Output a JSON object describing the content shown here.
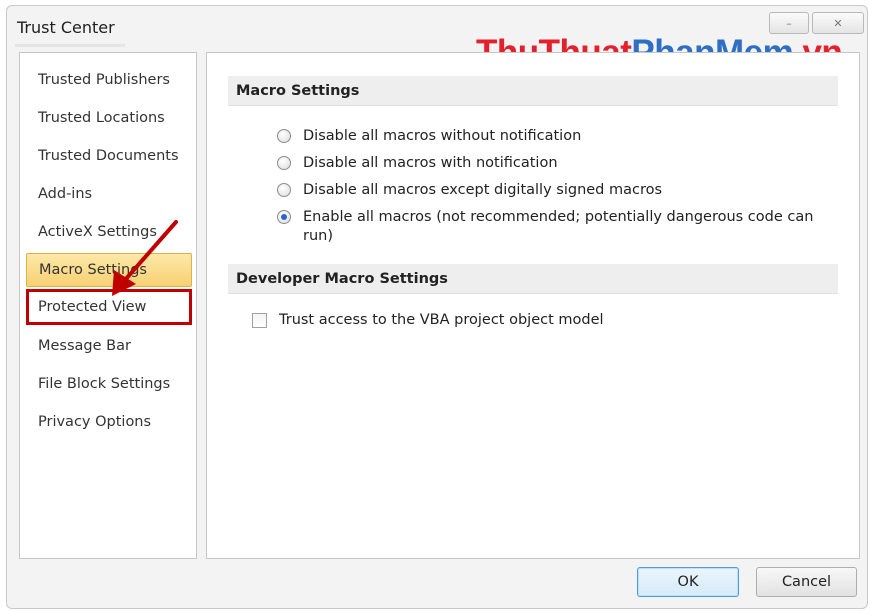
{
  "window": {
    "title": "Trust Center",
    "minimize_glyph": "–",
    "close_glyph": "✕"
  },
  "watermark": {
    "part1": "ThuThuat",
    "part2": "PhanMem",
    "part3": ".vn",
    "colors": {
      "red": "#e3202c",
      "blue": "#2e6fc4"
    }
  },
  "sidebar": {
    "items": [
      {
        "label": "Trusted Publishers"
      },
      {
        "label": "Trusted Locations"
      },
      {
        "label": "Trusted Documents"
      },
      {
        "label": "Add-ins"
      },
      {
        "label": "ActiveX Settings"
      },
      {
        "label": "Macro Settings",
        "selected": true
      },
      {
        "label": "Protected View",
        "highlighted": true
      },
      {
        "label": "Message Bar"
      },
      {
        "label": "File Block Settings"
      },
      {
        "label": "Privacy Options"
      }
    ]
  },
  "macro_settings": {
    "header": "Macro Settings",
    "options": [
      {
        "label": "Disable all macros without notification",
        "checked": false
      },
      {
        "label": "Disable all macros with notification",
        "checked": false
      },
      {
        "label": "Disable all macros except digitally signed macros",
        "checked": false
      },
      {
        "label_line1": "Enable all macros (not recommended; potentially dangerous code can",
        "label_line2": "run)",
        "checked": true
      }
    ]
  },
  "developer_settings": {
    "header": "Developer Macro Settings",
    "vba_label": "Trust access to the VBA project object model",
    "vba_checked": false
  },
  "buttons": {
    "ok": "OK",
    "cancel": "Cancel"
  },
  "annotation": {
    "arrow_color": "#c00000",
    "highlight_color": "#c00000"
  }
}
